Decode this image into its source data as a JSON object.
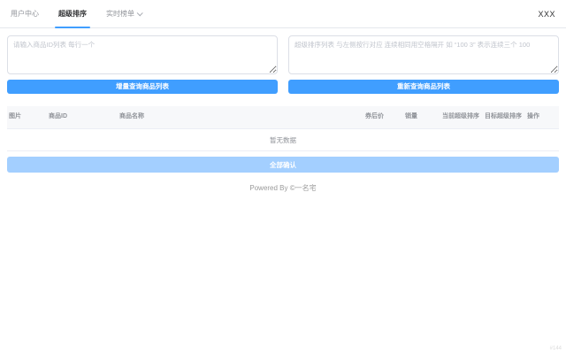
{
  "nav": {
    "tabs": [
      {
        "label": "用户中心",
        "active": false,
        "dropdown": false
      },
      {
        "label": "超级排序",
        "active": true,
        "dropdown": false
      },
      {
        "label": "实时榜单",
        "active": false,
        "dropdown": true
      }
    ],
    "user": "XXX"
  },
  "inputs": {
    "product_ids_placeholder": "请输入商品ID列表 每行一个",
    "sort_list_placeholder": "超级排序列表 与左侧按行对应 连续相同用空格隔开 如 “100 3” 表示连续三个 100"
  },
  "actions": {
    "incremental_query_label": "增量查询商品列表",
    "requery_label": "重新查询商品列表",
    "confirm_all_label": "全部确认"
  },
  "table": {
    "headers": [
      "图片",
      "商品ID",
      "商品名称",
      "券后价",
      "销量",
      "当前超级排序",
      "目标超级排序",
      "操作"
    ],
    "empty_text": "暂无数据"
  },
  "footer": {
    "powered_by": "Powered By ©一名宅",
    "corner_mark": "#144"
  },
  "colors": {
    "accent": "#409eff",
    "confirm_disabled": "#a3cfff",
    "header_text": "#909399"
  }
}
